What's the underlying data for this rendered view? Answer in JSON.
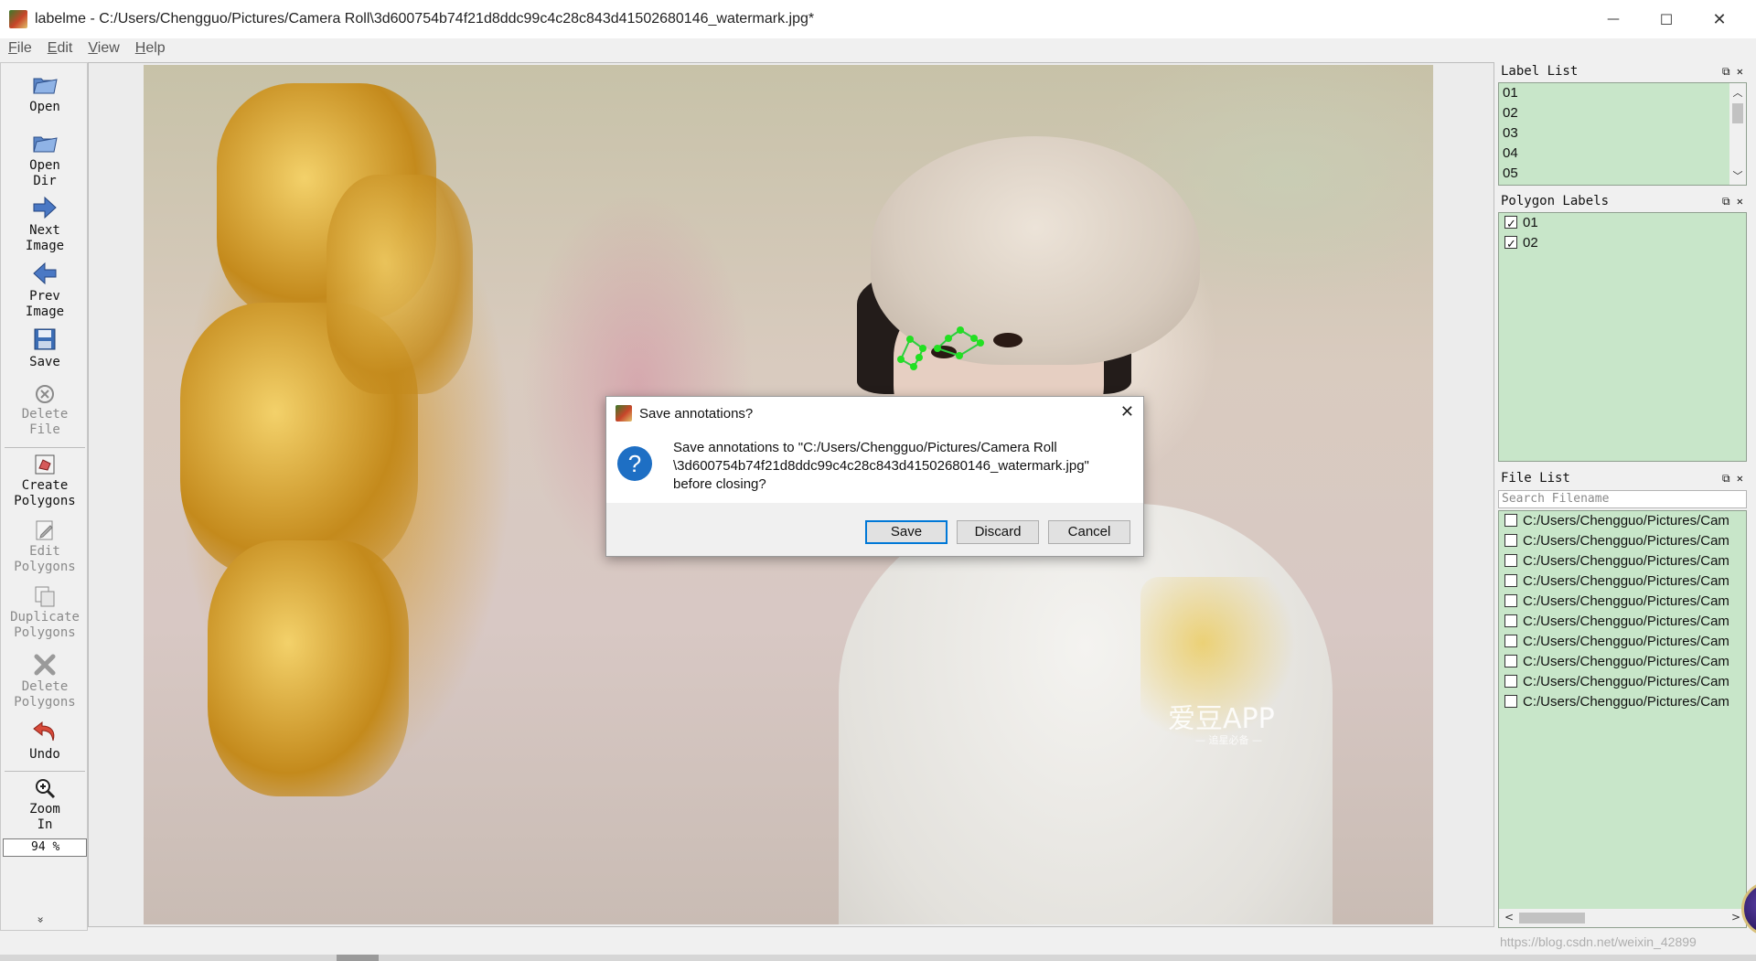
{
  "window": {
    "title": "labelme - C:/Users/Chengguo/Pictures/Camera Roll\\3d600754b74f21d8ddc99c4c28c843d41502680146_watermark.jpg*",
    "controls": {
      "minimize": "—",
      "maximize": "☐",
      "close": "✕"
    }
  },
  "menu": [
    {
      "underline": "F",
      "rest": "ile"
    },
    {
      "underline": "E",
      "rest": "dit"
    },
    {
      "underline": "V",
      "rest": "iew"
    },
    {
      "underline": "H",
      "rest": "elp"
    }
  ],
  "toolbar": {
    "open": {
      "line1": "Open",
      "line2": "",
      "icon": "folder-open-icon"
    },
    "open_dir": {
      "line1": "Open",
      "line2": "Dir",
      "icon": "folder-open-icon"
    },
    "next_image": {
      "line1": "Next",
      "line2": "Image",
      "icon": "arrow-right-icon"
    },
    "prev_image": {
      "line1": "Prev",
      "line2": "Image",
      "icon": "arrow-left-icon"
    },
    "save": {
      "line1": "Save",
      "line2": "",
      "icon": "floppy-icon"
    },
    "delete_file": {
      "line1": "Delete",
      "line2": "File",
      "icon": "delete-circle-icon",
      "enabled": false
    },
    "create_polygons": {
      "line1": "Create",
      "line2": "Polygons",
      "icon": "polygon-create-icon"
    },
    "edit_polygons": {
      "line1": "Edit",
      "line2": "Polygons",
      "icon": "edit-icon",
      "enabled": false
    },
    "duplicate_polygons": {
      "line1": "Duplicate",
      "line2": "Polygons",
      "icon": "copy-icon",
      "enabled": false
    },
    "delete_polygons": {
      "line1": "Delete",
      "line2": "Polygons",
      "icon": "cross-icon",
      "enabled": false
    },
    "undo": {
      "line1": "Undo",
      "line2": "",
      "icon": "undo-icon"
    },
    "zoom_in": {
      "line1": "Zoom",
      "line2": "In",
      "icon": "zoom-in-icon"
    },
    "zoom_value": "94 %",
    "more": "»"
  },
  "canvas": {
    "watermark_title": "爱豆APP",
    "watermark_sub": "— 追星必备 —"
  },
  "dialog": {
    "title": "Save annotations?",
    "message_lines": [
      "Save annotations to \"C:/Users/Chengguo/Pictures/Camera Roll",
      "\\3d600754b74f21d8ddc99c4c28c843d41502680146_watermark.jpg\"",
      "before closing?"
    ],
    "icon": "question-icon",
    "buttons": {
      "save": "Save",
      "discard": "Discard",
      "cancel": "Cancel"
    }
  },
  "label_list": {
    "title": "Label List",
    "items": [
      "01",
      "02",
      "03",
      "04",
      "05"
    ]
  },
  "polygon_labels": {
    "title": "Polygon Labels",
    "items": [
      {
        "label": "01",
        "checked": true
      },
      {
        "label": "02",
        "checked": true
      }
    ]
  },
  "file_list": {
    "title": "File List",
    "search_placeholder": "Search Filename",
    "items": [
      "C:/Users/Chengguo/Pictures/Cam",
      "C:/Users/Chengguo/Pictures/Cam",
      "C:/Users/Chengguo/Pictures/Cam",
      "C:/Users/Chengguo/Pictures/Cam",
      "C:/Users/Chengguo/Pictures/Cam",
      "C:/Users/Chengguo/Pictures/Cam",
      "C:/Users/Chengguo/Pictures/Cam",
      "C:/Users/Chengguo/Pictures/Cam",
      "C:/Users/Chengguo/Pictures/Cam",
      "C:/Users/Chengguo/Pictures/Cam"
    ]
  },
  "colors": {
    "panel_bg": "#c8e6c9",
    "annotation_point": "#22e022",
    "annotation_line": "#2ecc40",
    "dialog_primary_border": "#0078d7",
    "question_icon": "#1e6fc4"
  },
  "credit": "https://blog.csdn.net/weixin_42899"
}
